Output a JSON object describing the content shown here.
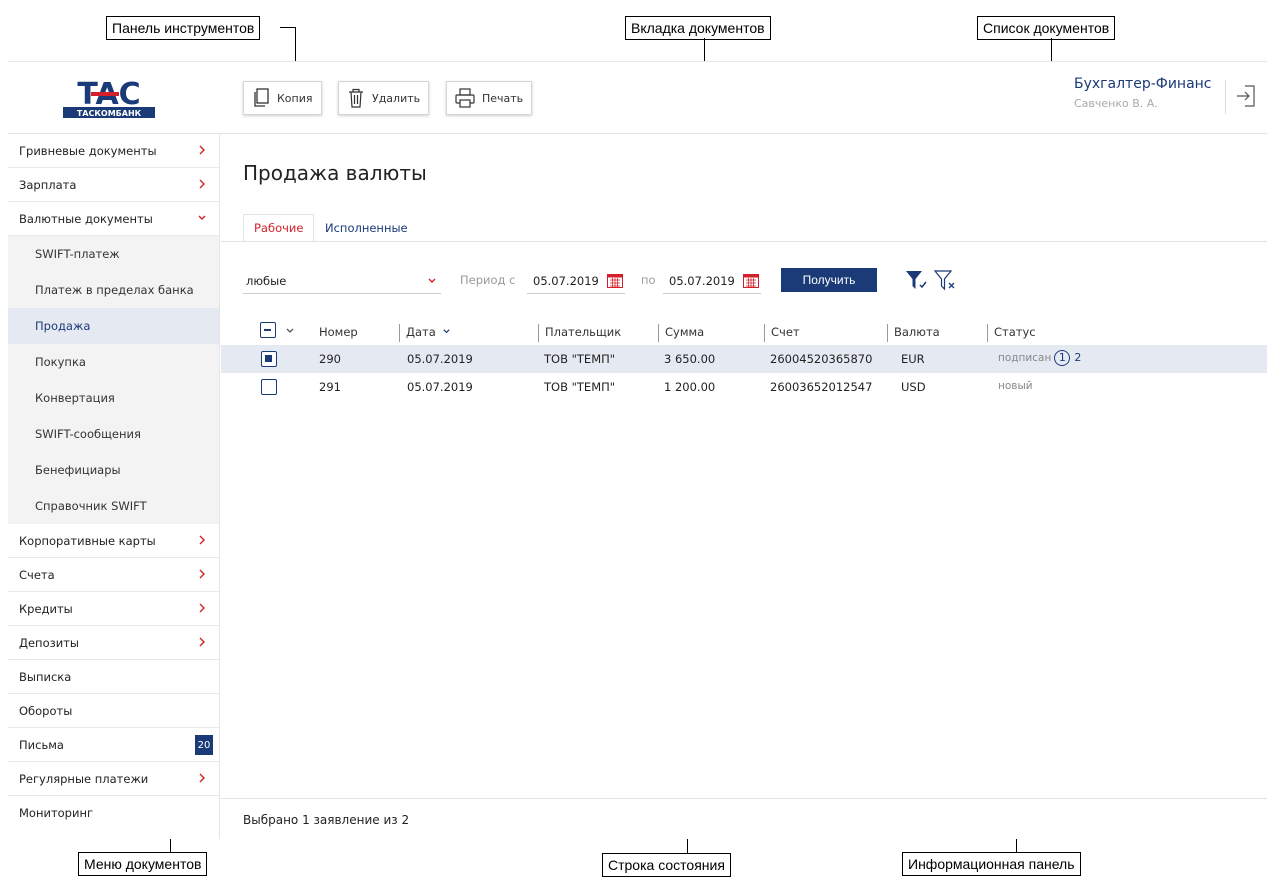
{
  "callouts": {
    "toolbar": "Панель инструментов",
    "doc_tab": "Вкладка документов",
    "doc_list": "Список документов",
    "doc_menu": "Меню документов",
    "status_bar": "Строка состояния",
    "info_panel": "Информационная панель"
  },
  "colors": {
    "brand": "#1a3a78",
    "accent_red": "#d4202a",
    "selected_row": "#e5e9f1"
  },
  "header": {
    "logo_text": "TAC",
    "logo_subtext": "ТАСКОМБАНК",
    "toolbar": [
      {
        "label": "Копия",
        "icon": "copy-icon"
      },
      {
        "label": "Удалить",
        "icon": "trash-icon"
      },
      {
        "label": "Печать",
        "icon": "print-icon"
      }
    ],
    "user_name": "Бухгалтер-Финанс",
    "user_sub": "Савченко В. А.",
    "logout_icon": "logout-icon"
  },
  "sidebar": {
    "items": [
      {
        "label": "Гривневые документы",
        "chevron": "right"
      },
      {
        "label": "Зарплата",
        "chevron": "right"
      },
      {
        "label": "Валютные документы",
        "chevron": "down"
      },
      {
        "label": "SWIFT-платеж"
      },
      {
        "label": "Платеж в пределах банка"
      },
      {
        "label": "Продажа",
        "active": true
      },
      {
        "label": "Покупка"
      },
      {
        "label": "Конвертация"
      },
      {
        "label": "SWIFT-сообщения"
      },
      {
        "label": "Бенефициары"
      },
      {
        "label": "Справочник SWIFT"
      },
      {
        "label": "Корпоративные карты",
        "chevron": "right"
      },
      {
        "label": "Счета",
        "chevron": "right"
      },
      {
        "label": "Кредиты",
        "chevron": "right"
      },
      {
        "label": "Депозиты",
        "chevron": "right"
      },
      {
        "label": "Выписка"
      },
      {
        "label": "Обороты"
      },
      {
        "label": "Письма",
        "badge": "20"
      },
      {
        "label": "Регулярные платежи",
        "chevron": "right"
      },
      {
        "label": "Мониторинг"
      }
    ]
  },
  "main": {
    "title": "Продажа валюты",
    "tabs": [
      {
        "label": "Рабочие",
        "active": true
      },
      {
        "label": "Исполненные"
      }
    ],
    "filter": {
      "select_value": "любые",
      "period_from_label": "Период с",
      "date_from": "05.07.2019",
      "period_to_label": "по",
      "date_to": "05.07.2019",
      "get_button": "Получить"
    },
    "table": {
      "columns": [
        "Номер",
        "Дата",
        "Плательщик",
        "Сумма",
        "Счет",
        "Валюта",
        "Статус"
      ],
      "rows": [
        {
          "number": "290",
          "date": "05.07.2019",
          "payer": "ТОВ \"ТЕМП\"",
          "amount": "3 650.00",
          "account": "26004520365870",
          "currency": "EUR",
          "status": "подписан",
          "sign_circle": "1",
          "sign_extra": "2",
          "selected": true
        },
        {
          "number": "291",
          "date": "05.07.2019",
          "payer": "ТОВ \"ТЕМП\"",
          "amount": "1 200.00",
          "account": "26003652012547",
          "currency": "USD",
          "status": "новый",
          "selected": false
        }
      ]
    },
    "status_text": "Выбрано 1 заявление из 2"
  }
}
